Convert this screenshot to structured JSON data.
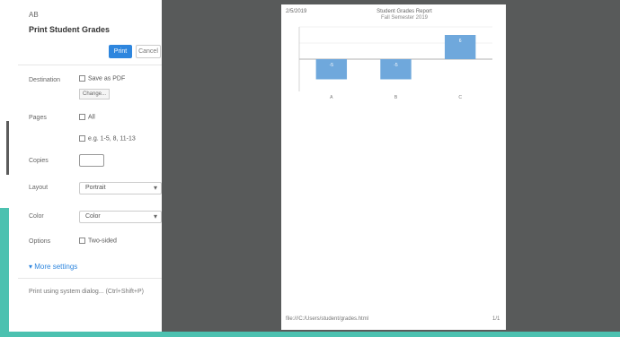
{
  "panel": {
    "header_small": "AB",
    "title": "Print Student Grades",
    "primary_button": "Print",
    "secondary_button": "Cancel",
    "destination_label": "Destination",
    "destination_value": "Save as PDF",
    "change_button": "Change...",
    "pages_label": "Pages",
    "pages_option_all": "All",
    "pages_option_custom": "e.g. 1-5, 8, 11-13",
    "copies_label": "Copies",
    "copies_value": "",
    "layout_label": "Layout",
    "layout_value": "Portrait",
    "color_label": "Color",
    "color_value": "Color",
    "options_label": "Options",
    "options_value": "Two-sided",
    "more_settings": "More settings",
    "footer": "Print using system dialog... (Ctrl+Shift+P)"
  },
  "preview": {
    "header_left": "2/5/2019",
    "title": "Student Grades Report",
    "subtitle": "Fall Semester 2019",
    "footer_left": "file:///C:/Users/student/grades.html",
    "footer_right": "1/1"
  },
  "colors": {
    "accent": "#2e86de",
    "teal": "#4cc1b0",
    "dark_bg": "#585a5a",
    "bar": "#6fa8dc"
  },
  "chart_data": {
    "type": "bar",
    "categories": [
      "A",
      "B",
      "C"
    ],
    "values": [
      -5,
      -5,
      6
    ],
    "ylim": [
      -8,
      8
    ]
  }
}
